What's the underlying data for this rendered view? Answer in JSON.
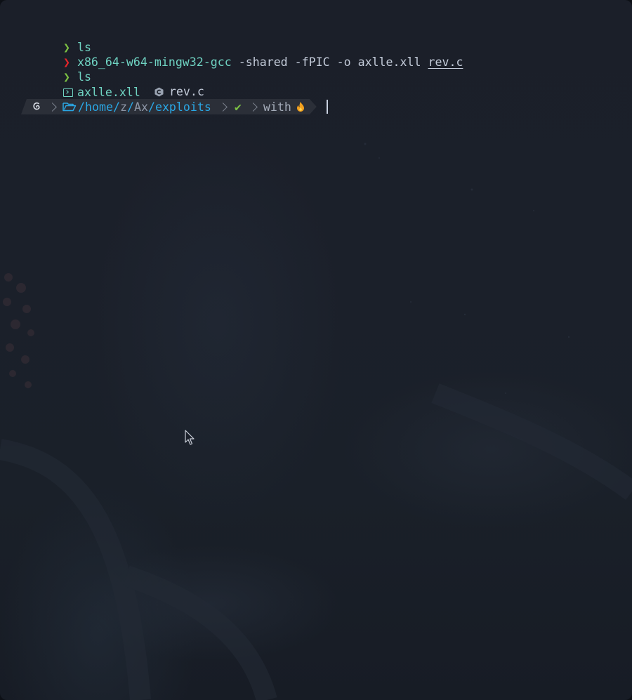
{
  "history": [
    {
      "prompt": "❯",
      "status": "ok",
      "command": "ls",
      "args": []
    },
    {
      "prompt": "❯",
      "status": "error",
      "command": "x86_64-w64-mingw32-gcc",
      "args_text": " -shared -fPIC -o axlle.xll ",
      "underlined_arg": "rev.c"
    },
    {
      "prompt": "❯",
      "status": "ok",
      "command": "ls",
      "args": []
    }
  ],
  "ls_output": [
    {
      "name": "axlle.xll",
      "icon": "terminal-file-icon"
    },
    {
      "name": "rev.c",
      "icon": "c-language-icon"
    }
  ],
  "promptbar": {
    "os_icon": "debian-swirl-icon",
    "path": {
      "root_sep": "/",
      "home": "home",
      "sep1": "/",
      "user": "z",
      "sep2": "/",
      "dir": "Ax",
      "sep3": "/",
      "leaf": "exploits"
    },
    "status_check": "✔",
    "with_label": "with",
    "flame_icon": "fire-icon"
  },
  "colors": {
    "prompt_ok": "#7bc043",
    "prompt_error": "#e5252a",
    "command": "#6fd3c2",
    "path_accent": "#2aa8e6",
    "flame": "#f2a01e"
  }
}
